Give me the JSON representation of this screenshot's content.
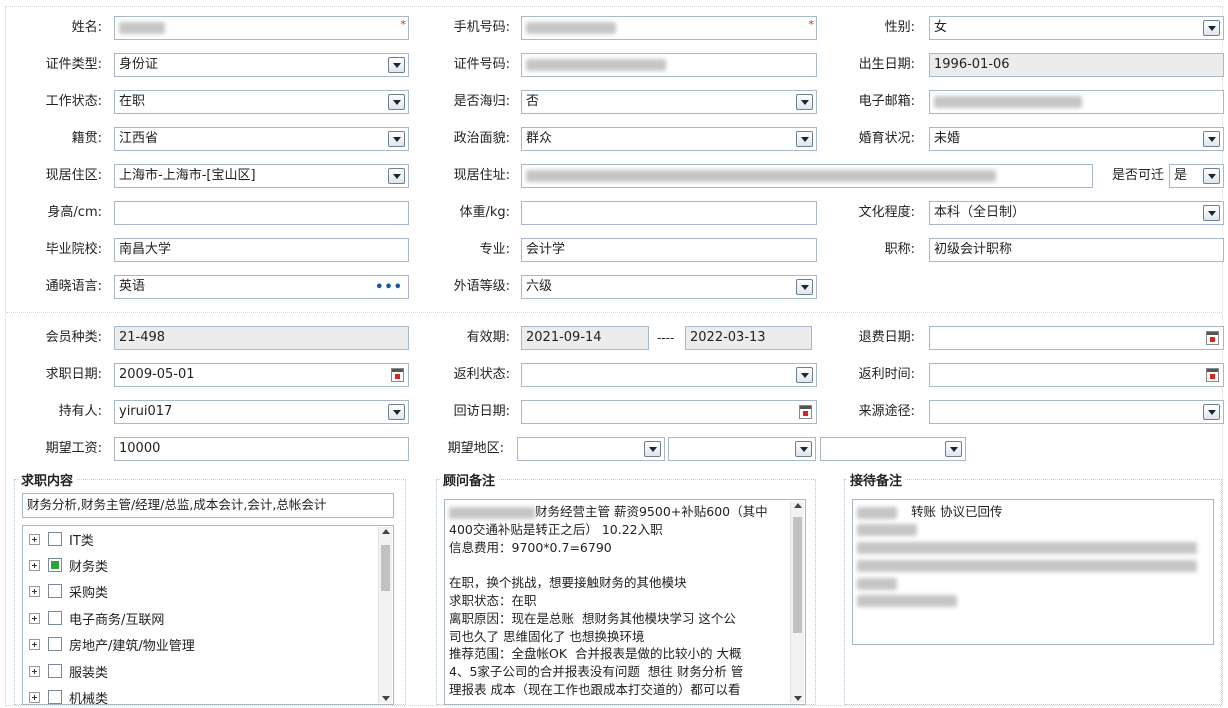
{
  "personal": {
    "name_label": "姓名:",
    "phone_label": "手机号码:",
    "gender_label": "性别:",
    "gender_value": "女",
    "idtype_label": "证件类型:",
    "idtype_value": "身份证",
    "idno_label": "证件号码:",
    "birth_label": "出生日期:",
    "birth_value": "1996-01-06",
    "workstatus_label": "工作状态:",
    "workstatus_value": "在职",
    "returnee_label": "是否海归:",
    "returnee_value": "否",
    "email_label": "电子邮箱:",
    "native_label": "籍贯:",
    "native_value": "江西省",
    "political_label": "政治面貌:",
    "political_value": "群众",
    "marital_label": "婚育状况:",
    "marital_value": "未婚",
    "region_label": "现居住区:",
    "region_value": "上海市-上海市-[宝山区]",
    "address_label": "现居住址:",
    "relocate_label": "是否可迁",
    "relocate_value": "是",
    "height_label": "身高/cm:",
    "weight_label": "体重/kg:",
    "education_label": "文化程度:",
    "education_value": "本科（全日制）",
    "school_label": "毕业院校:",
    "school_value": "南昌大学",
    "major_label": "专业:",
    "major_value": "会计学",
    "title_label": "职称:",
    "title_value": "初级会计职称",
    "language_label": "通晓语言:",
    "language_value": "英语",
    "langlevel_label": "外语等级:",
    "langlevel_value": "六级"
  },
  "membership": {
    "type_label": "会员种类:",
    "type_value": "21-498",
    "validity_label": "有效期:",
    "valid_from": "2021-09-14",
    "valid_sep": "----",
    "valid_to": "2022-03-13",
    "refund_label": "退费日期:",
    "jobdate_label": "求职日期:",
    "jobdate_value": "2009-05-01",
    "rebate_status_label": "返利状态:",
    "rebate_time_label": "返利时间:",
    "holder_label": "持有人:",
    "holder_value": "yirui017",
    "visit_label": "回访日期:",
    "source_label": "来源途径:",
    "salary_label": "期望工资:",
    "salary_value": "10000",
    "area_label": "期望地区:"
  },
  "job_content": {
    "title": "求职内容",
    "summary": "财务分析,财务主管/经理/总监,成本会计,会计,总帐会计",
    "categories": [
      {
        "label": "IT类",
        "checked": false
      },
      {
        "label": "财务类",
        "checked": true
      },
      {
        "label": "采购类",
        "checked": false
      },
      {
        "label": "电子商务/互联网",
        "checked": false
      },
      {
        "label": "房地产/建筑/物业管理",
        "checked": false
      },
      {
        "label": "服装类",
        "checked": false
      },
      {
        "label": "机械类",
        "checked": false
      }
    ]
  },
  "consultant_notes": {
    "title": "顾问备注",
    "lines": [
      "财务经营主管 薪资9500+补贴600（其中",
      "400交通补贴是转正之后） 10.22入职",
      "信息费用：9700*0.7=6790",
      "",
      "在职，换个挑战，想要接触财务的其他模块",
      "求职状态：在职",
      "离职原因：现在是总账  想财务其他模块学习 这个公",
      "司也久了 思维固化了 也想换换环境",
      "推荐范围：全盘帐OK  合并报表是做的比较小的 大概",
      "4、5家子公司的合并报表没有问题  想往 财务分析 管",
      "理报表 成本（现在工作也跟成本打交道的）都可以看"
    ]
  },
  "reception_notes": {
    "title": "接待备注",
    "first_line": "转账 协议已回传"
  }
}
